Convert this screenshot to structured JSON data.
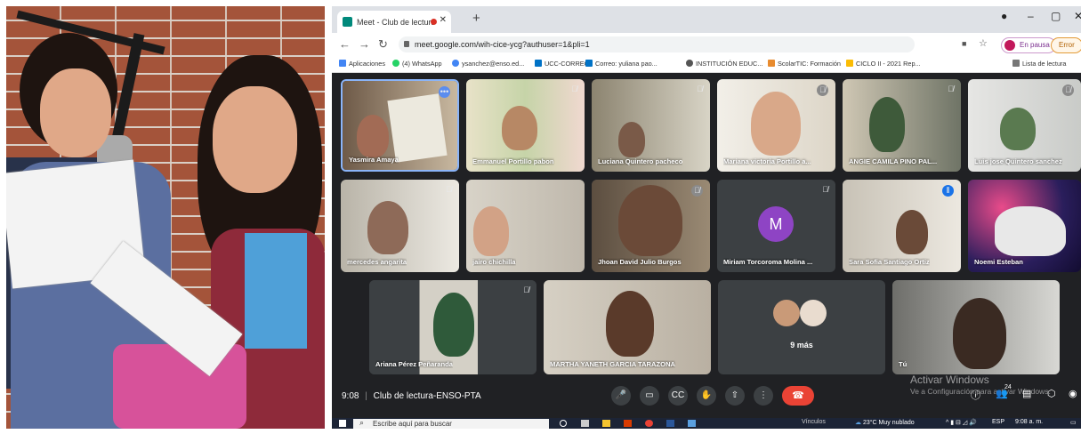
{
  "browser": {
    "tab_title": "Meet - Club de lectura-ENSC",
    "url": "meet.google.com/wih-cice-ycg?authuser=1&pli=1",
    "profile_status": "En pausa",
    "error_label": "Error"
  },
  "bookmarks": [
    "Aplicaciones",
    "(4) WhatsApp",
    "ysanchez@enso.ed...",
    "UCC-CORREO",
    "Correo: yuliana pao...",
    "INSTITUCIÓN EDUC...",
    "ScolarTIC: Formación",
    "CICLO II - 2021 Rep...",
    "Lista de lectura"
  ],
  "participants_row1": [
    {
      "name": "Yasmira Amaya"
    },
    {
      "name": "Emmanuel Portillo pabon"
    },
    {
      "name": "Luciana Quintero pacheco"
    },
    {
      "name": "Mariana victoria Portillo a..."
    },
    {
      "name": "ANGIE CAMILA PINO PAL..."
    },
    {
      "name": "Luis jose Quintero sanchez"
    }
  ],
  "participants_row2": [
    {
      "name": "mercedes angarita"
    },
    {
      "name": "jairo chichilla"
    },
    {
      "name": "Jhoan David Julio Burgos"
    },
    {
      "name": "Miriam Torcoroma Molina ...",
      "avatar": "M"
    },
    {
      "name": "Sara Sofia Santiago Ortiz"
    },
    {
      "name": "Noemi Esteban"
    }
  ],
  "participants_row3": [
    {
      "name": "Ariana Pérez Peñaranda"
    },
    {
      "name": "MARTHA YANETH GARCIA TARAZONA"
    },
    {
      "name": "9 más"
    },
    {
      "name": "Tú"
    }
  ],
  "meeting": {
    "time": "9:08",
    "title": "Club de lectura-ENSO-PTA",
    "participant_count": "24"
  },
  "watermark": {
    "title": "Activar Windows",
    "subtitle": "Ve a Configuración para activar Windows."
  },
  "taskbar": {
    "search_placeholder": "Escribe aquí para buscar",
    "links": "Vínculos",
    "weather": "23°C  Muy nublado",
    "lang": "ESP",
    "clock": "9:08 a. m."
  },
  "colors": {
    "meet_bg": "#202124",
    "tile_bg": "#3c4043",
    "hangup": "#ea4335",
    "active_border": "#8ab4f8"
  }
}
